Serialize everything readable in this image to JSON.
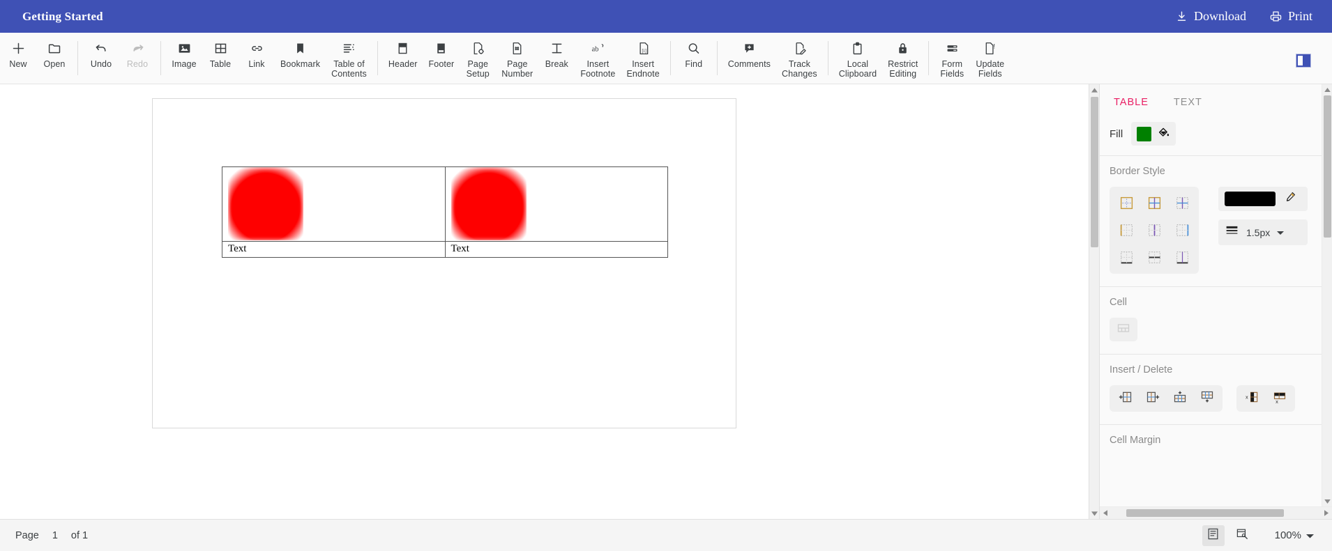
{
  "titlebar": {
    "app_title": "Getting Started",
    "download_label": "Download",
    "print_label": "Print",
    "background_color": "#3f51b5"
  },
  "toolbar": {
    "groups": [
      {
        "items": [
          {
            "label": "New",
            "icon": "plus-icon",
            "disabled": false
          },
          {
            "label": "Open",
            "icon": "folder-icon",
            "disabled": false
          }
        ]
      },
      {
        "items": [
          {
            "label": "Undo",
            "icon": "undo-icon",
            "disabled": false
          },
          {
            "label": "Redo",
            "icon": "redo-icon",
            "disabled": true
          }
        ]
      },
      {
        "items": [
          {
            "label": "Image",
            "icon": "image-icon",
            "disabled": false
          },
          {
            "label": "Table",
            "icon": "table-icon",
            "disabled": false
          },
          {
            "label": "Link",
            "icon": "link-icon",
            "disabled": false
          },
          {
            "label": "Bookmark",
            "icon": "bookmark-icon",
            "disabled": false
          },
          {
            "label": "Table of\nContents",
            "icon": "table-of-contents-icon",
            "disabled": false
          }
        ]
      },
      {
        "items": [
          {
            "label": "Header",
            "icon": "header-icon",
            "disabled": false
          },
          {
            "label": "Footer",
            "icon": "footer-icon",
            "disabled": false
          },
          {
            "label": "Page\nSetup",
            "icon": "page-setup-icon",
            "disabled": false
          },
          {
            "label": "Page\nNumber",
            "icon": "page-number-icon",
            "disabled": false
          },
          {
            "label": "Break",
            "icon": "break-icon",
            "disabled": false
          },
          {
            "label": "Insert\nFootnote",
            "icon": "insert-footnote-icon",
            "disabled": false
          },
          {
            "label": "Insert\nEndnote",
            "icon": "insert-endnote-icon",
            "disabled": false
          }
        ]
      },
      {
        "items": [
          {
            "label": "Find",
            "icon": "search-icon",
            "disabled": false
          }
        ]
      },
      {
        "items": [
          {
            "label": "Comments",
            "icon": "comment-add-icon",
            "disabled": false
          },
          {
            "label": "Track\nChanges",
            "icon": "track-changes-icon",
            "disabled": false
          }
        ]
      },
      {
        "items": [
          {
            "label": "Local\nClipboard",
            "icon": "clipboard-icon",
            "disabled": false
          },
          {
            "label": "Restrict\nEditing",
            "icon": "lock-icon",
            "disabled": false
          }
        ]
      },
      {
        "items": [
          {
            "label": "Form\nFields",
            "icon": "form-fields-icon",
            "disabled": false
          },
          {
            "label": "Update\nFields",
            "icon": "update-fields-icon",
            "disabled": false
          }
        ]
      }
    ],
    "panel_toggle_icon": "properties-panel-icon",
    "panel_toggle_color": "#3f51b5"
  },
  "document": {
    "table": {
      "rows": [
        {
          "cells": [
            {
              "type": "image",
              "image_color": "#fe0000"
            },
            {
              "type": "image",
              "image_color": "#fe0000"
            }
          ]
        },
        {
          "cells": [
            {
              "type": "text",
              "text": "Text"
            },
            {
              "type": "text",
              "text": "Text"
            }
          ]
        }
      ]
    }
  },
  "side_panel": {
    "tabs": [
      {
        "label": "TABLE",
        "active": true
      },
      {
        "label": "TEXT",
        "active": false
      }
    ],
    "active_tab_color": "#e91e63",
    "fill": {
      "label": "Fill",
      "color": "#008000",
      "bucket_icon": "paint-bucket-icon"
    },
    "border_style": {
      "title": "Border Style",
      "options": [
        "border-box-icon",
        "border-all-icon",
        "border-inside-icon",
        "border-left-icon",
        "border-inside-vertical-icon",
        "border-right-icon",
        "border-top-icon",
        "border-inside-horizontal-icon",
        "border-bottom-icon"
      ],
      "color": "#000000",
      "pen_icon": "border-color-pen-icon",
      "width_value": "1.5px",
      "width_icon": "line-weight-icon",
      "dropdown_icon": "chevron-down-icon"
    },
    "cell": {
      "title": "Cell",
      "merge_icon": "merge-cells-icon",
      "merge_disabled": true
    },
    "insert_delete": {
      "title": "Insert / Delete",
      "buttons": [
        "insert-column-left-icon",
        "insert-column-right-icon",
        "insert-row-above-icon",
        "insert-row-below-icon"
      ],
      "delete_buttons": [
        "delete-column-icon",
        "delete-row-icon"
      ]
    },
    "cell_margin": {
      "title": "Cell Margin"
    }
  },
  "statusbar": {
    "page_label": "Page",
    "page_number": "1",
    "of_label": "of 1",
    "view_icon": "page-view-icon",
    "web_layout_icon": "web-layout-icon",
    "zoom_level": "100%",
    "zoom_dropdown_icon": "chevron-down-icon"
  }
}
